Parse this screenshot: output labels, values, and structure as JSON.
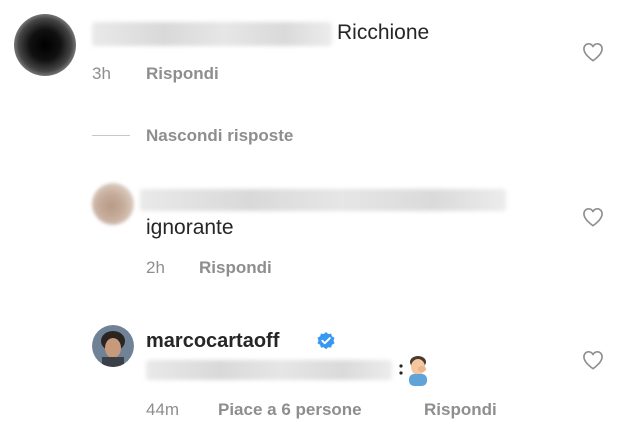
{
  "comments": [
    {
      "text": "Ricchione",
      "time": "3h",
      "reply_label": "Rispondi"
    },
    {
      "text": "ignorante",
      "time": "2h",
      "reply_label": "Rispondi"
    },
    {
      "username": "marcocartaoff",
      "verified": true,
      "emoji": "🤦‍♂️",
      "time": "44m",
      "likes_label": "Piace a 6 persone",
      "reply_label": "Rispondi"
    }
  ],
  "hide_replies_label": "Nascondi risposte",
  "icons": {
    "like": "heart-outline-icon",
    "verified": "verified-badge-icon"
  },
  "colors": {
    "text": "#262626",
    "secondary": "#8e8e8e",
    "verified_blue": "#3897f0"
  }
}
